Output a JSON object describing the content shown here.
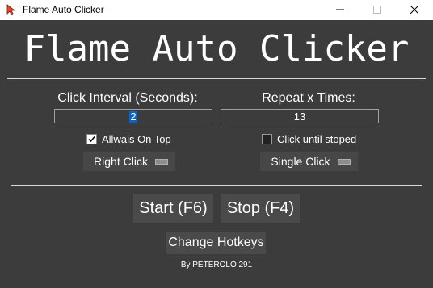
{
  "window": {
    "title": "Flame Auto Clicker",
    "icon": "flame-cursor-icon",
    "controls": [
      "minimize-icon",
      "maximize-icon",
      "close-icon"
    ]
  },
  "main": {
    "heading": "Flame Auto Clicker",
    "interval_label": "Click Interval (Seconds):",
    "interval_value": "2",
    "repeat_label": "Repeat x Times:",
    "repeat_value": "13",
    "always_on_top_label": "Allwais On Top",
    "always_on_top_checked": true,
    "click_until_stopped_label": "Click until stoped",
    "click_until_stopped_checked": false,
    "mouse_button": "Right Click",
    "click_type": "Single Click",
    "start_label": "Start (F6)",
    "stop_label": "Stop (F4)",
    "hotkeys_label": "Change Hotkeys",
    "credit": "By PETEROLO 291"
  },
  "colors": {
    "background": "#3c3c3c",
    "button": "#4a4a4a",
    "text": "#ffffff",
    "selection": "#0a64c8"
  }
}
